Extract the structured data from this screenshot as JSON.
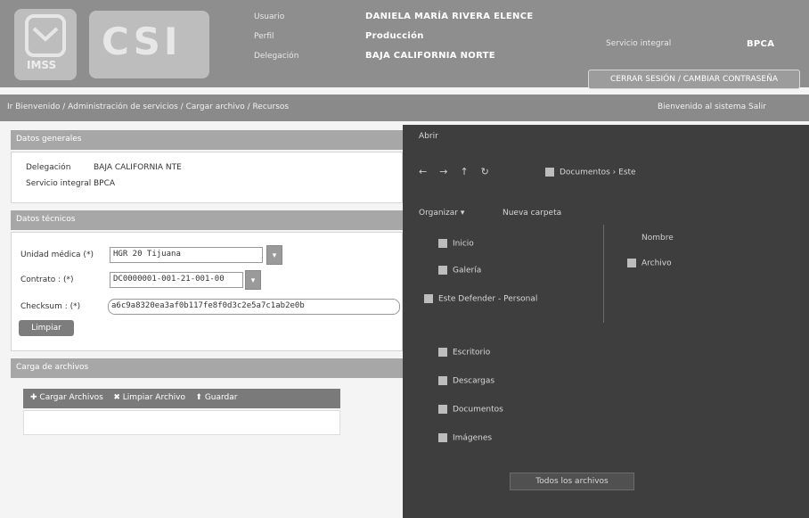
{
  "header": {
    "logo_imss_text": "IMSS",
    "logo_csi_text": "CSI",
    "labels": [
      "Usuario",
      "Perfil",
      "Delegación"
    ],
    "values": [
      "DANIELA MARÍA RIVERA ELENCE",
      "Producción",
      "BAJA CALIFORNIA NORTE"
    ],
    "right_label": "Servicio integral",
    "right_value": "BPCA",
    "account_button": "CERRAR SESIÓN / CAMBIAR CONTRASEÑA"
  },
  "nav": {
    "breadcrumb": "Ir Bienvenido / Administración de servicios / Cargar archivo / Recursos",
    "user": "Bienvenido al sistema   Salir"
  },
  "panel1": {
    "title": "Datos generales",
    "rows": [
      {
        "label": "Delegación",
        "value": "BAJA CALIFORNIA NTE"
      },
      {
        "label": "Servicio integral :",
        "value": "BPCA"
      }
    ]
  },
  "panel2": {
    "title": "Datos técnicos",
    "unidad_label": "Unidad médica (*)",
    "unidad_value": "HGR 20 Tijuana",
    "unidad_btn": "▾",
    "contrato_label": "Contrato : (*)",
    "contrato_value": "DC0000001-001-21-001-00",
    "contrato_btn": "▾",
    "checksum_label": "Checksum : (*)",
    "checksum_value": "a6c9a8320ea3af0b117fe8f0d3c2e5a7c1ab2e0b",
    "button": "Limpiar"
  },
  "panel3": {
    "title": "Carga de archivos",
    "tabs": [
      "Cargar Archivos",
      "Limpiar Archivo",
      "Guardar"
    ]
  },
  "dialog": {
    "title": "Abrir",
    "path": "Documentos › Este",
    "toolbar_left": "Organizar ▾",
    "toolbar_mid": "Nueva carpeta",
    "col_header": "Nombre",
    "nav_top": [
      "Inicio",
      "Galería",
      "Este Defender - Personal"
    ],
    "nav_bottom": [
      "Escritorio",
      "Descargas",
      "Documentos",
      "Imágenes"
    ],
    "file_item": "Archivo",
    "bottom_button": "Todos los archivos"
  }
}
